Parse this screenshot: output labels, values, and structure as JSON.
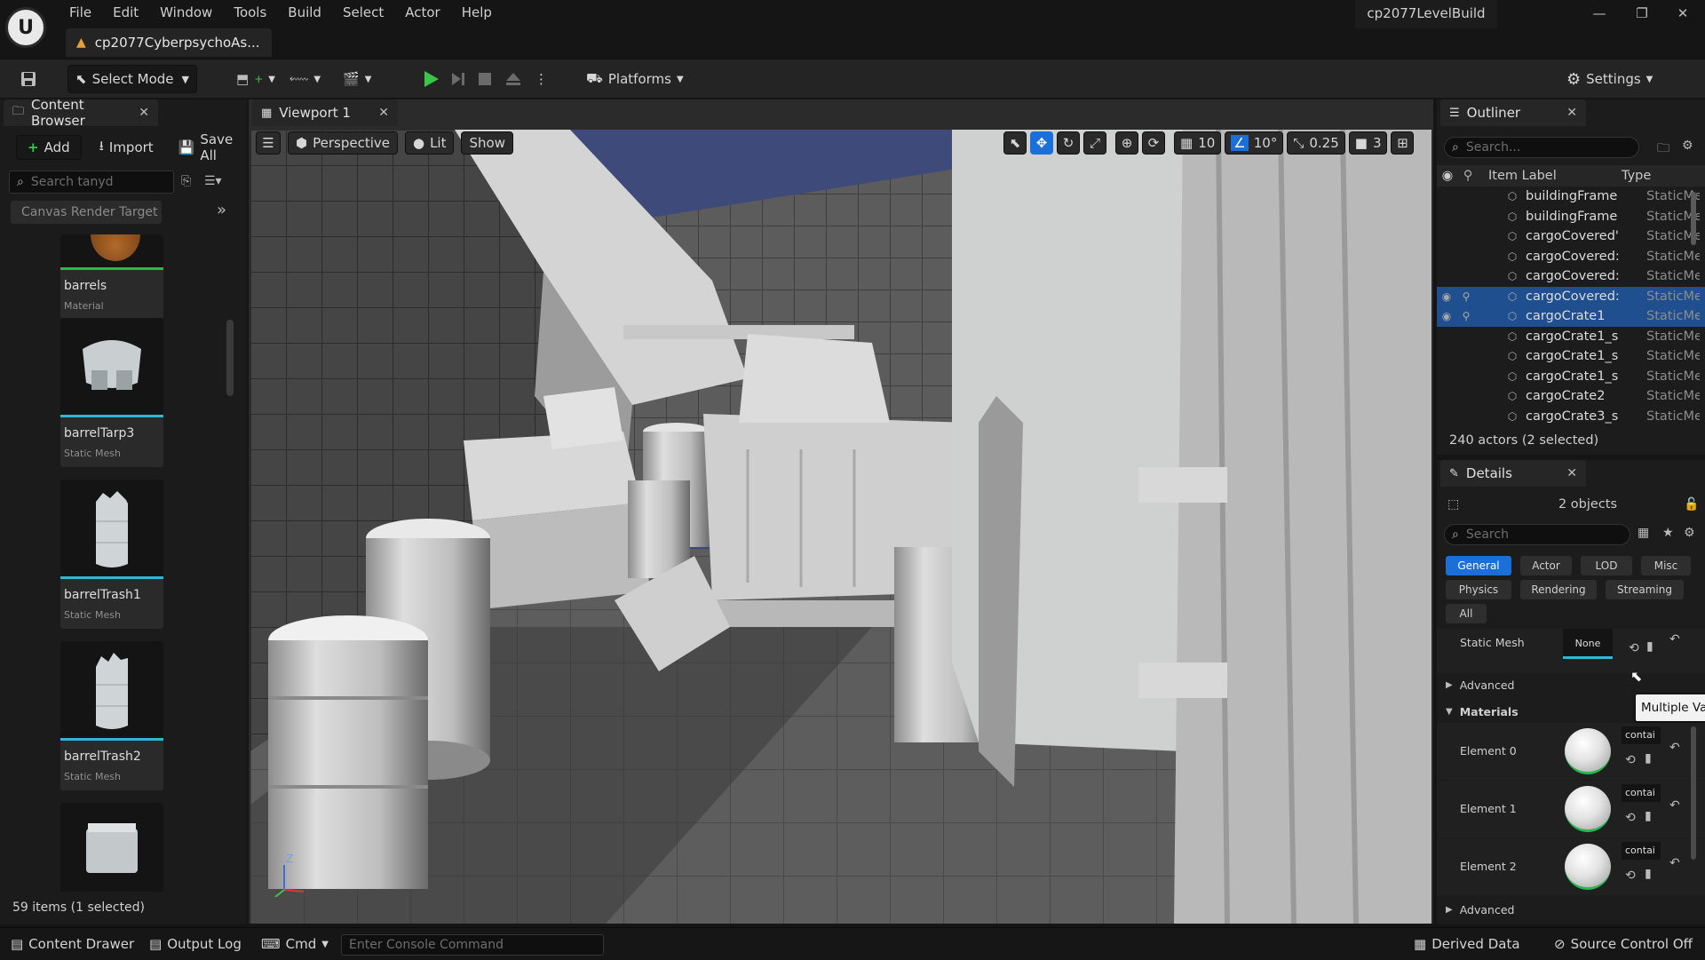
{
  "app": {
    "window_title": "cp2077LevelBuild",
    "document_tab": "cp2077CyberpsychoAs...",
    "menu": [
      "File",
      "Edit",
      "Window",
      "Tools",
      "Build",
      "Select",
      "Actor",
      "Help"
    ]
  },
  "toolbar": {
    "select_mode": "Select Mode",
    "platforms": "Platforms",
    "settings": "Settings"
  },
  "content_browser": {
    "tab_label": "Content Browser",
    "add_label": "Add",
    "import_label": "Import",
    "save_all_label": "Save All",
    "search_placeholder": "Search tanyd",
    "filter_chip": "Canvas Render Target",
    "items_status": "59 items (1 selected)",
    "assets": [
      {
        "name": "barrels",
        "kind": "Material"
      },
      {
        "name": "barrelTarp3",
        "kind": "Static Mesh"
      },
      {
        "name": "barrelTrash1",
        "kind": "Static Mesh"
      },
      {
        "name": "barrelTrash2",
        "kind": "Static Mesh"
      }
    ]
  },
  "viewport": {
    "tab_label": "Viewport 1",
    "perspective_label": "Perspective",
    "lit_label": "Lit",
    "show_label": "Show",
    "grid_snap": "10",
    "rot_snap": "10°",
    "scale_snap": "0.25",
    "camera_speed": "3",
    "axis_labels": {
      "z": "Z"
    }
  },
  "outliner": {
    "tab_label": "Outliner",
    "search_placeholder": "Search...",
    "col_label": "Item Label",
    "col_type": "Type",
    "rows": [
      {
        "label": "buildingFrame",
        "type": "StaticMe",
        "selected": false
      },
      {
        "label": "buildingFrame",
        "type": "StaticMe",
        "selected": false
      },
      {
        "label": "cargoCovered'",
        "type": "StaticMe",
        "selected": false
      },
      {
        "label": "cargoCovered:",
        "type": "StaticMe",
        "selected": false
      },
      {
        "label": "cargoCovered:",
        "type": "StaticMe",
        "selected": false
      },
      {
        "label": "cargoCovered:",
        "type": "StaticMe",
        "selected": true
      },
      {
        "label": "cargoCrate1",
        "type": "StaticMe",
        "selected": true
      },
      {
        "label": "cargoCrate1_s",
        "type": "StaticMe",
        "selected": false
      },
      {
        "label": "cargoCrate1_s",
        "type": "StaticMe",
        "selected": false
      },
      {
        "label": "cargoCrate1_s",
        "type": "StaticMe",
        "selected": false
      },
      {
        "label": "cargoCrate2",
        "type": "StaticMe",
        "selected": false
      },
      {
        "label": "cargoCrate3_s",
        "type": "StaticMe",
        "selected": false
      }
    ],
    "status": "240 actors (2 selected)"
  },
  "details": {
    "tab_label": "Details",
    "objects": "2 objects",
    "search_placeholder": "Search",
    "filters_row1": [
      "General",
      "Actor",
      "LOD",
      "Misc"
    ],
    "filters_row2": [
      "Physics",
      "Rendering",
      "Streaming"
    ],
    "filters_row3": [
      "All"
    ],
    "static_mesh_label": "Static Mesh",
    "static_mesh_value": "None",
    "tooltip": "Multiple Values",
    "advanced_label": "Advanced",
    "materials_label": "Materials",
    "elements": [
      {
        "label": "Element 0",
        "value": "contai"
      },
      {
        "label": "Element 1",
        "value": "contai"
      },
      {
        "label": "Element 2",
        "value": "contai"
      }
    ],
    "advanced_label_2": "Advanced"
  },
  "statusbar": {
    "content_drawer": "Content Drawer",
    "output_log": "Output Log",
    "cmd": "Cmd",
    "console_placeholder": "Enter Console Command",
    "derived_data": "Derived Data",
    "source_control": "Source Control Off"
  },
  "colors": {
    "accent": "#1a6fd8",
    "selection": "#1f4f8f",
    "play_green": "#3cc34a",
    "asset_bar": "#2fb7d6"
  }
}
